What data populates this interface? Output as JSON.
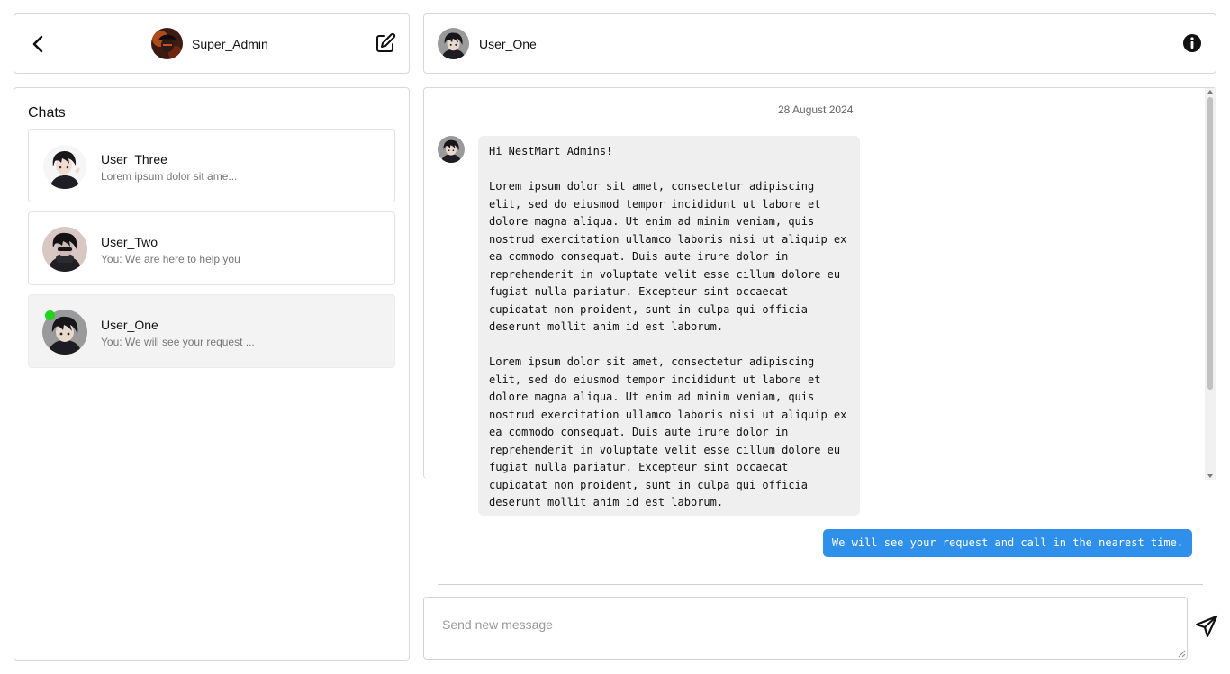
{
  "left_header": {
    "username": "Super_Admin",
    "icons": {
      "back": "chevron-left-icon",
      "edit": "edit-icon"
    }
  },
  "chats": {
    "title": "Chats",
    "items": [
      {
        "name": "User_Three",
        "preview": "Lorem ipsum dolor sit ame...",
        "active": false,
        "online": false
      },
      {
        "name": "User_Two",
        "preview": "You: We are here to help you",
        "active": false,
        "online": false
      },
      {
        "name": "User_One",
        "preview": "You: We will see your request ...",
        "active": true,
        "online": true
      }
    ]
  },
  "right_header": {
    "username": "User_One",
    "icons": {
      "info": "info-icon"
    }
  },
  "conversation": {
    "date": "28 August 2024",
    "incoming_text": "Hi NestMart Admins!\n\nLorem ipsum dolor sit amet, consectetur adipiscing\nelit, sed do eiusmod tempor incididunt ut labore et\ndolore magna aliqua. Ut enim ad minim veniam, quis\nnostrud exercitation ullamco laboris nisi ut aliquip ex\nea commodo consequat. Duis aute irure dolor in\nreprehenderit in voluptate velit esse cillum dolore eu\nfugiat nulla pariatur. Excepteur sint occaecat\ncupidatat non proident, sunt in culpa qui officia\ndeserunt mollit anim id est laborum.\n\nLorem ipsum dolor sit amet, consectetur adipiscing\nelit, sed do eiusmod tempor incididunt ut labore et\ndolore magna aliqua. Ut enim ad minim veniam, quis\nnostrud exercitation ullamco laboris nisi ut aliquip ex\nea commodo consequat. Duis aute irure dolor in\nreprehenderit in voluptate velit esse cillum dolore eu\nfugiat nulla pariatur. Excepteur sint occaecat\ncupidatat non proident, sunt in culpa qui officia\ndeserunt mollit anim id est laborum.",
    "outgoing_text": "We will see your request and call in the nearest time."
  },
  "composer": {
    "value": "",
    "placeholder": "Send new message",
    "send_icon": "send-icon"
  },
  "colors": {
    "accent": "#2f90ec",
    "online": "#20d41a",
    "incoming_bubble": "#efefef",
    "active_chat": "#f3f3f3"
  }
}
